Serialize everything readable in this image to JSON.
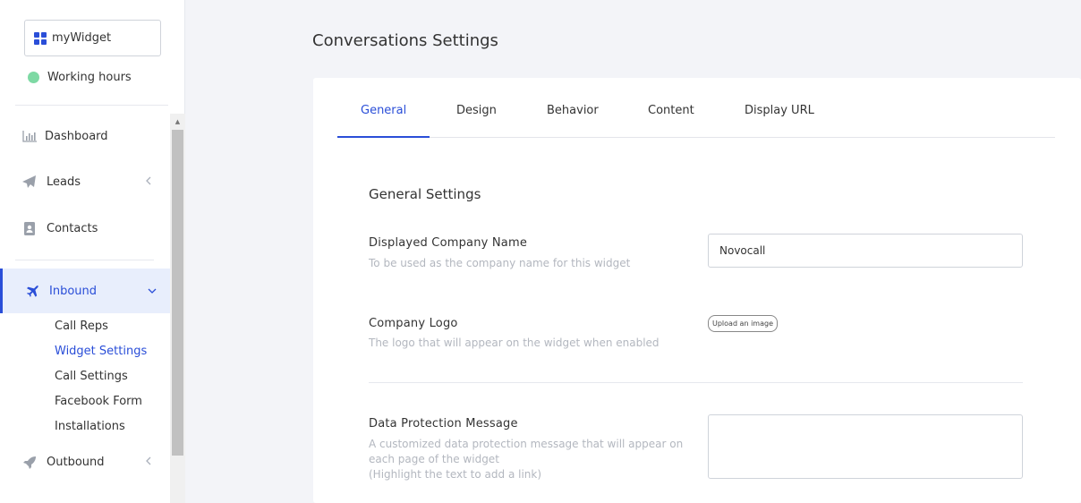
{
  "sidebar": {
    "widget_name": "myWidget",
    "working_hours": "Working hours",
    "nav": {
      "dashboard": "Dashboard",
      "leads": "Leads",
      "contacts": "Contacts",
      "inbound": "Inbound",
      "outbound": "Outbound"
    },
    "inbound_sub": {
      "call_reps": "Call Reps",
      "widget_settings": "Widget Settings",
      "call_settings": "Call Settings",
      "facebook_form": "Facebook Form",
      "installations": "Installations"
    }
  },
  "main": {
    "title": "Conversations Settings",
    "tabs": {
      "general": "General",
      "design": "Design",
      "behavior": "Behavior",
      "content": "Content",
      "display_url": "Display URL"
    },
    "section_title": "General Settings",
    "company_name": {
      "label": "Displayed Company Name",
      "help": "To be used as the company name for this widget",
      "value": "Novocall"
    },
    "company_logo": {
      "label": "Company Logo",
      "help": "The logo that will appear on the widget when enabled",
      "button": "Upload an image"
    },
    "data_protection": {
      "label": "Data Protection Message",
      "help_line1": "A customized data protection message that will appear on",
      "help_line2": "each page of the widget",
      "help_line3": "(Highlight the text to add a link)",
      "value": ""
    }
  },
  "colors": {
    "accent": "#2a4ed8",
    "status_dot": "#7ed9a4",
    "background": "#f3f4f8"
  }
}
